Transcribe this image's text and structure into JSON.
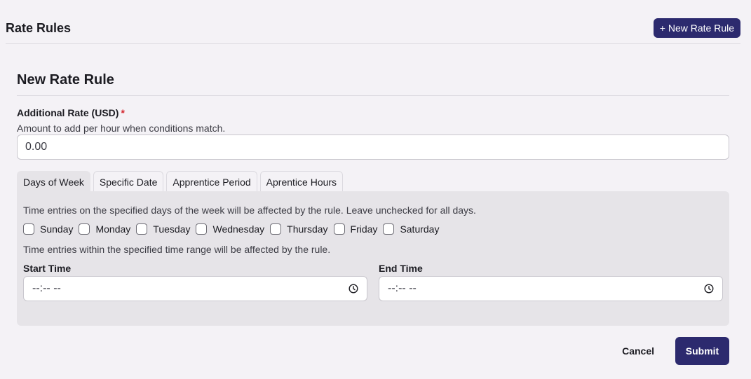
{
  "header": {
    "title": "Rate Rules",
    "new_button_label": "+ New Rate Rule"
  },
  "form": {
    "title": "New Rate Rule",
    "rate_field": {
      "label": "Additional Rate (USD)",
      "required_mark": "*",
      "help": "Amount to add per hour when conditions match.",
      "value": "0.00"
    },
    "tabs": [
      {
        "label": "Days of Week",
        "active": true
      },
      {
        "label": "Specific Date",
        "active": false
      },
      {
        "label": "Apprentice Period",
        "active": false
      },
      {
        "label": "Aprentice Hours",
        "active": false
      }
    ],
    "days_panel": {
      "description": "Time entries on the specified days of the week will be affected by the rule. Leave unchecked for all days.",
      "days": [
        "Sunday",
        "Monday",
        "Tuesday",
        "Wednesday",
        "Thursday",
        "Friday",
        "Saturday"
      ],
      "time_description": "Time entries within the specified time range will be affected by the rule.",
      "start_time": {
        "label": "Start Time",
        "value": "--:-- --",
        "icon": "clock-icon"
      },
      "end_time": {
        "label": "End Time",
        "value": "--:-- --",
        "icon": "clock-icon"
      }
    },
    "actions": {
      "cancel_label": "Cancel",
      "submit_label": "Submit"
    }
  },
  "colors": {
    "primary": "#2c2a6e",
    "background": "#f4f2f6",
    "panel": "#e6e4e8",
    "required": "#d4262e"
  }
}
